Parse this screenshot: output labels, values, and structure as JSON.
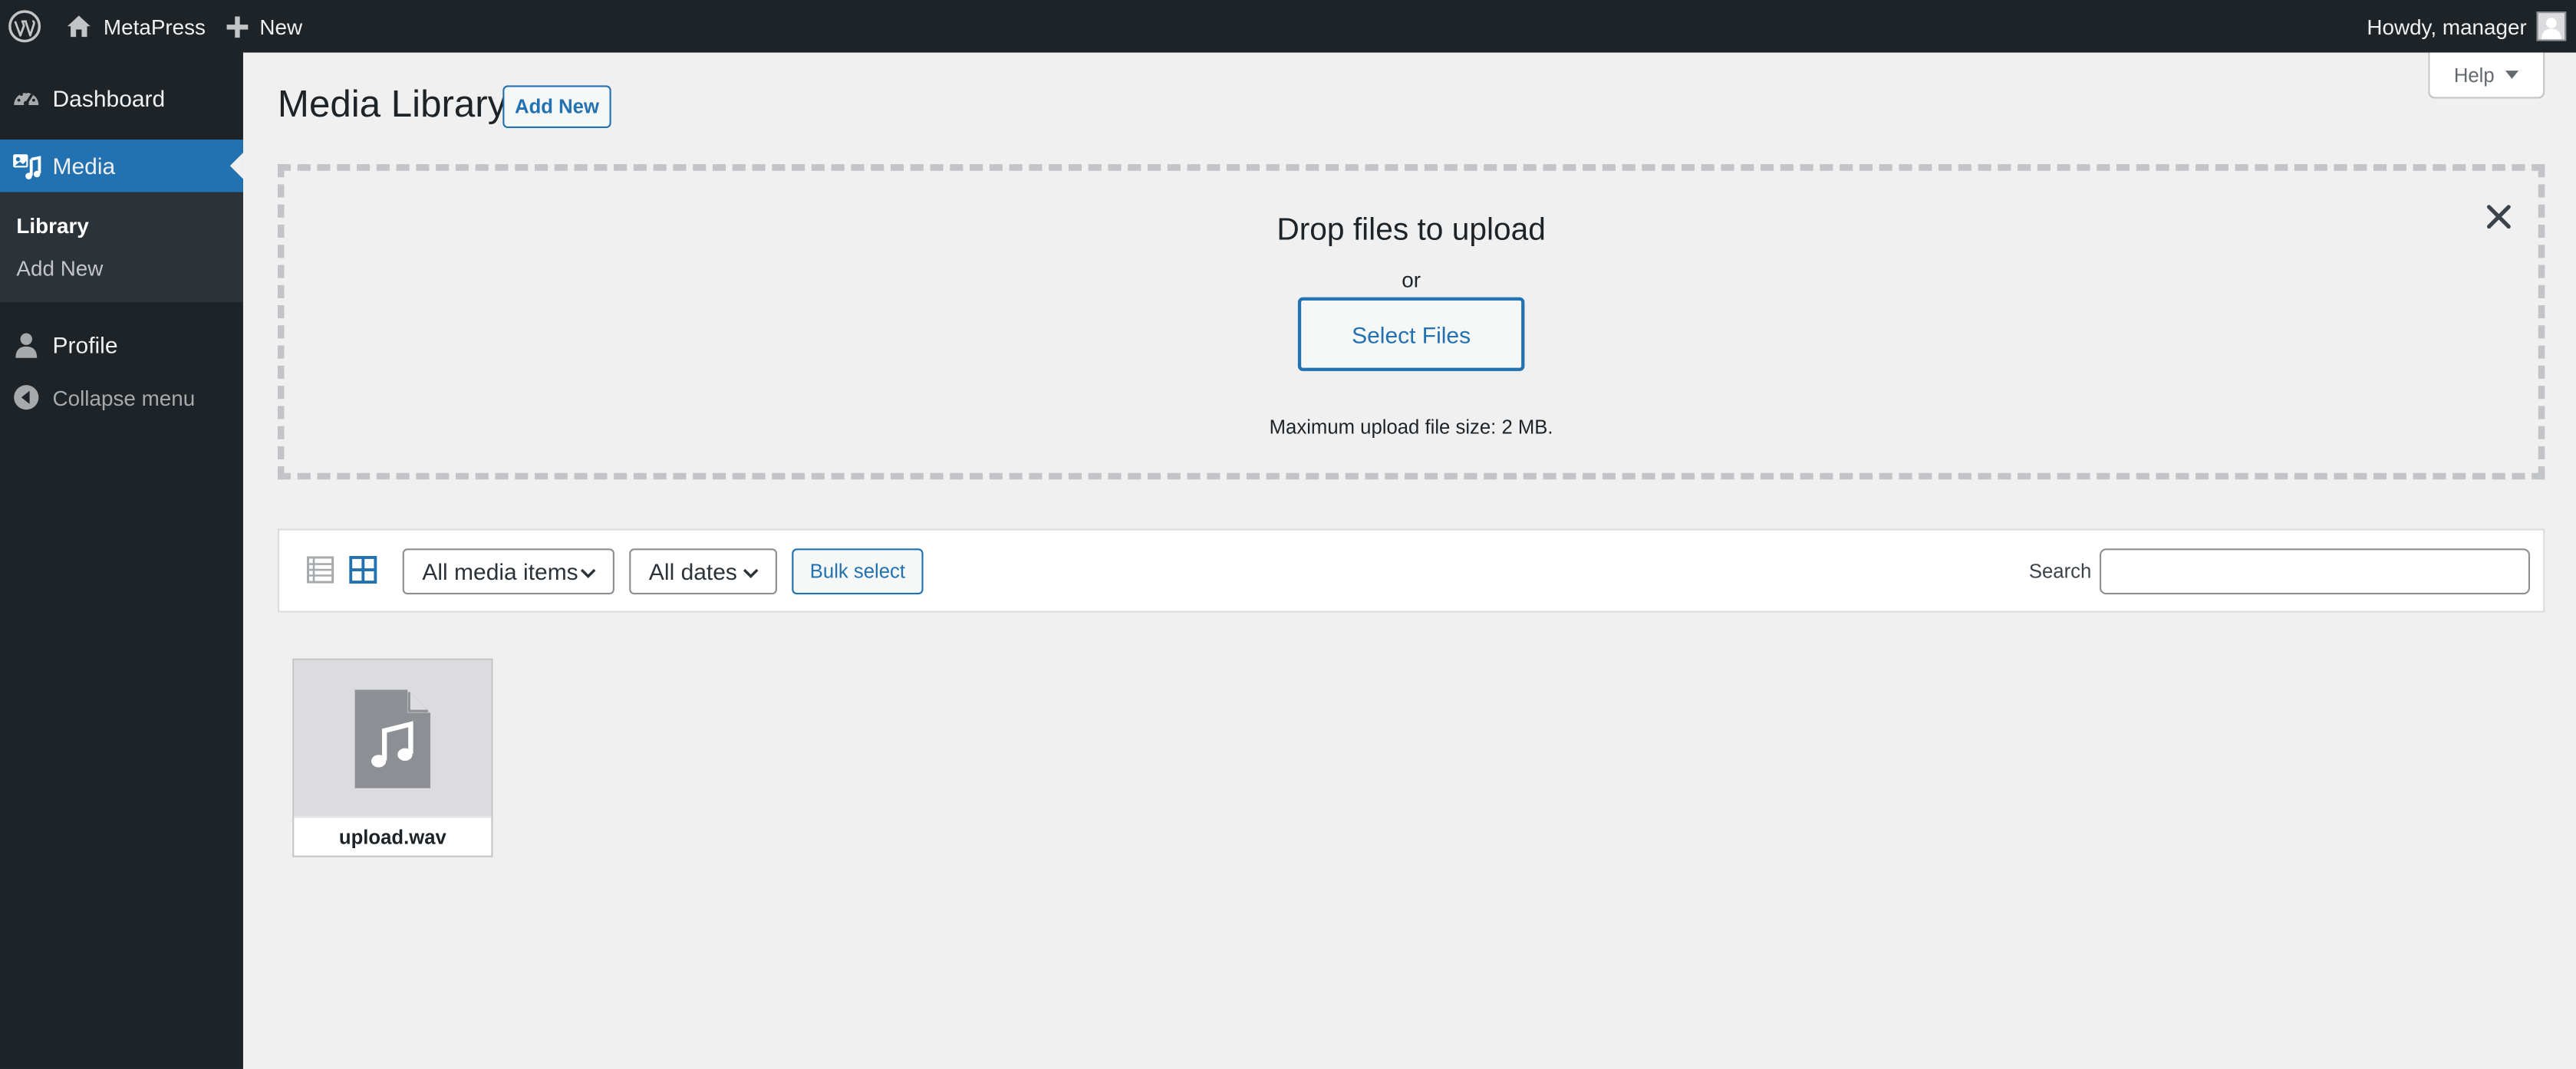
{
  "adminbar": {
    "site_name": "MetaPress",
    "new_label": "New",
    "howdy": "Howdy, manager",
    "icons": {
      "wp": "wordpress-logo-icon",
      "site": "home-icon",
      "new": "plus-icon",
      "avatar": "user-avatar-icon"
    }
  },
  "sidebar": {
    "items": [
      {
        "label": "Dashboard",
        "icon": "dashboard-icon"
      },
      {
        "label": "Media",
        "icon": "media-icon",
        "active": true
      },
      {
        "label": "Profile",
        "icon": "user-icon"
      },
      {
        "label": "Collapse menu",
        "icon": "collapse-icon"
      }
    ],
    "media_submenu": [
      {
        "label": "Library",
        "current": true
      },
      {
        "label": "Add New"
      }
    ]
  },
  "header": {
    "title": "Media Library",
    "add_new": "Add New",
    "help": "Help"
  },
  "uploader": {
    "title": "Drop files to upload",
    "or": "or",
    "select_files": "Select Files",
    "max_size": "Maximum upload file size: 2 MB."
  },
  "toolbar": {
    "type_filter": "All media items",
    "date_filter": "All dates",
    "bulk_select": "Bulk select",
    "search_label": "Search",
    "search_value": ""
  },
  "attachments": [
    {
      "filename": "upload.wav",
      "icon": "audio-file-icon"
    }
  ],
  "colors": {
    "adminbar_bg": "#1d2327",
    "accent": "#2271b1",
    "content_bg": "#f0f0f1"
  }
}
